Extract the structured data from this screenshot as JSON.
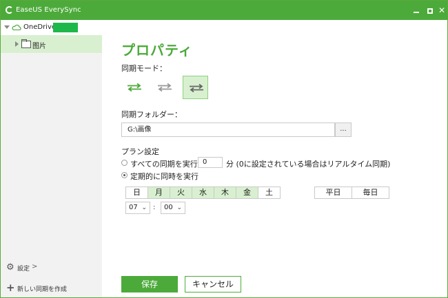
{
  "window": {
    "title": "EaseUS EverySync"
  },
  "sidebar": {
    "account": {
      "label": "OneDrive"
    },
    "folder": {
      "label": "图片"
    },
    "settings_label": "設定",
    "settings_chevron": ">",
    "new_sync_label": "新しい同期を作成"
  },
  "main": {
    "title": "プロパティ",
    "sync_mode_label": "同期モード：",
    "sync_folder_label": "同期フォルダー：",
    "folder_path": "G:\\画像",
    "browse_label": "...",
    "plan_label": "プラン設定",
    "option_all": {
      "text_before": "すべての同期を実行",
      "value": "0",
      "text_after": "分 (0に設定されている場合はリアルタイム同期)",
      "selected": false
    },
    "option_periodic": {
      "text": "定期的に同時を実行",
      "selected": true
    },
    "days": [
      {
        "label": "日",
        "selected": false
      },
      {
        "label": "月",
        "selected": true
      },
      {
        "label": "火",
        "selected": true
      },
      {
        "label": "水",
        "selected": true
      },
      {
        "label": "木",
        "selected": true
      },
      {
        "label": "金",
        "selected": true
      },
      {
        "label": "土",
        "selected": false
      }
    ],
    "quick_select": {
      "weekdays": "平日",
      "everyday": "毎日"
    },
    "time": {
      "hour": "07",
      "minute": "00",
      "separator": ":"
    },
    "save_label": "保存",
    "cancel_label": "キャンセル"
  },
  "colors": {
    "accent": "#4caa3a",
    "selected_bg": "#d8f0d0",
    "account_redaction": "#1eb84a"
  }
}
